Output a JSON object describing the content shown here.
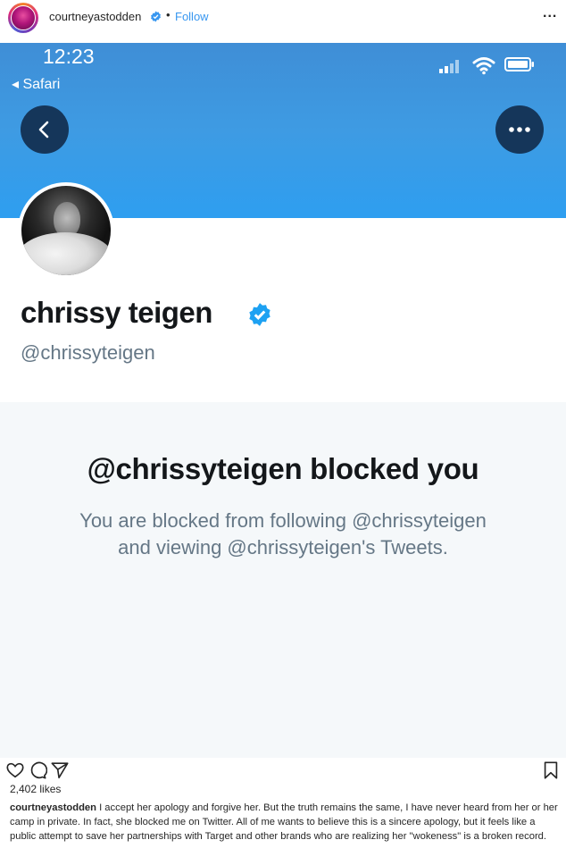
{
  "post": {
    "username": "courtneyastodden",
    "dot": "•",
    "follow_label": "Follow",
    "more_label": "...",
    "likes": "2,402 likes",
    "caption_user": "courtneyastodden",
    "caption_text": "I accept her apology and forgive her. But the truth remains the same, I have never heard from her or her camp in private. In fact, she blocked me on Twitter. All of me wants to believe this is a sincere apology, but it feels like a public attempt to save her partnerships with Target and other brands who are realizing her \"wokeness\" is a broken record."
  },
  "phone": {
    "time": "12:23",
    "back_app": "◂ Safari"
  },
  "profile": {
    "name": "chrissy teigen",
    "handle": "@chrissyteigen",
    "blocked_title": "@chrissyteigen blocked you",
    "blocked_line1": "You are blocked from following @chrissyteigen",
    "blocked_line2": "and viewing @chrissyteigen's Tweets."
  },
  "icons": {
    "verified": "verified-badge-icon",
    "heart": "heart-icon",
    "comment": "comment-icon",
    "share": "share-icon",
    "bookmark": "bookmark-icon",
    "back": "chevron-left-icon",
    "more": "more-dots-icon"
  },
  "colors": {
    "instagram_link": "#3897f0",
    "twitter_blue": "#1da1f2",
    "banner": "#3e9be3"
  }
}
